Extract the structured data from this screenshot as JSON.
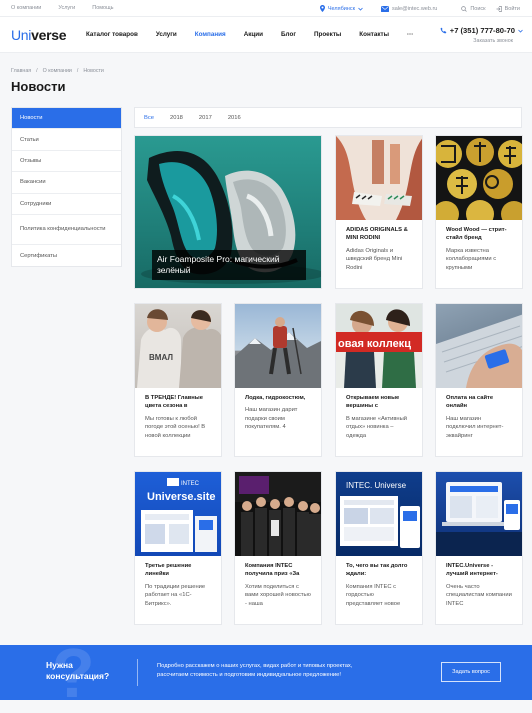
{
  "topbar": {
    "links": [
      "О компании",
      "Услуги",
      "Помощь"
    ],
    "city": "Челябинск",
    "email": "sale@intec.web.ru",
    "search": "Поиск",
    "login": "Войти"
  },
  "header": {
    "logo_part1": "Uni",
    "logo_part2": "verse",
    "nav": [
      "Каталог товаров",
      "Услуги",
      "Компания",
      "Акции",
      "Блог",
      "Проекты",
      "Контакты",
      "···"
    ],
    "phone": "+7 (351) 777-80-70",
    "callback": "Заказать звонок"
  },
  "breadcrumbs": [
    "Главная",
    "/",
    "О компании",
    "/",
    "Новости"
  ],
  "page_title": "Новости",
  "sidebar": [
    {
      "label": "Новости"
    },
    {
      "label": "Статьи"
    },
    {
      "label": "Отзывы"
    },
    {
      "label": "Вакансии"
    },
    {
      "label": "Сотрудники"
    },
    {
      "label": "Политика конфиденциальности"
    },
    {
      "label": "Сертификаты"
    }
  ],
  "years": [
    "Все",
    "2018",
    "2017",
    "2016"
  ],
  "cards": [
    {
      "title": "Air Foamposite Pro: магический зелёный",
      "desc": ""
    },
    {
      "title": "ADIDAS ORIGINALS & MINI RODINI",
      "desc": "Adidas Originals и шведский бренд Mini Rodini"
    },
    {
      "title": "Wood Wood — стрит-стайл бренд",
      "desc": "Марка известна коллаборациями с крупными"
    },
    {
      "title": "В ТРЕНДЕ! Главные цвета сезона в",
      "desc": "Мы готовы к любой погоде этой осенью! В новой коллекции"
    },
    {
      "title": "Лодка, гидрокостюм,",
      "desc": "Наш магазин дарит подарки своим покупателям. 4"
    },
    {
      "title": "Открываем новые вершины с",
      "desc": "В магазине «Активный отдых» новинка – одежда"
    },
    {
      "title": "Оплата на сайте онлайн",
      "desc": "Наш магазин подключил интернет-эквайринг"
    },
    {
      "title": "Третье решение линейки",
      "desc": "По традиции решение работает на «1С-Битрикс»."
    },
    {
      "title": "Компания INTEC получила приз «За",
      "desc": "Хотим поделиться с вами хорошей новостью - наша"
    },
    {
      "title": "То, чего вы так долго ждали:",
      "desc": "Компания INTEC с гордостью представляет новое"
    },
    {
      "title": "INTEC.Universe - лучший интернет-",
      "desc": "Очень часто специалистам компании INTEC"
    }
  ],
  "img_text": {
    "hoodie": "ВМАЛ",
    "collection": "овая коллекц",
    "intec_badge": "INTEC",
    "universe_site": "Universe.site",
    "intec_universe": "INTEC. Universe"
  },
  "footer": {
    "heading_1": "Нужна",
    "heading_2": "консультация?",
    "text_1": "Подробно расскажем о наших услугах, видах работ и типовых проектах,",
    "text_2": "рассчитаем стоимость и подготовим индивидуальное предложение!",
    "button": "Задать вопрос",
    "watermark": "?"
  },
  "colors": {
    "accent": "#2a6ee8"
  }
}
